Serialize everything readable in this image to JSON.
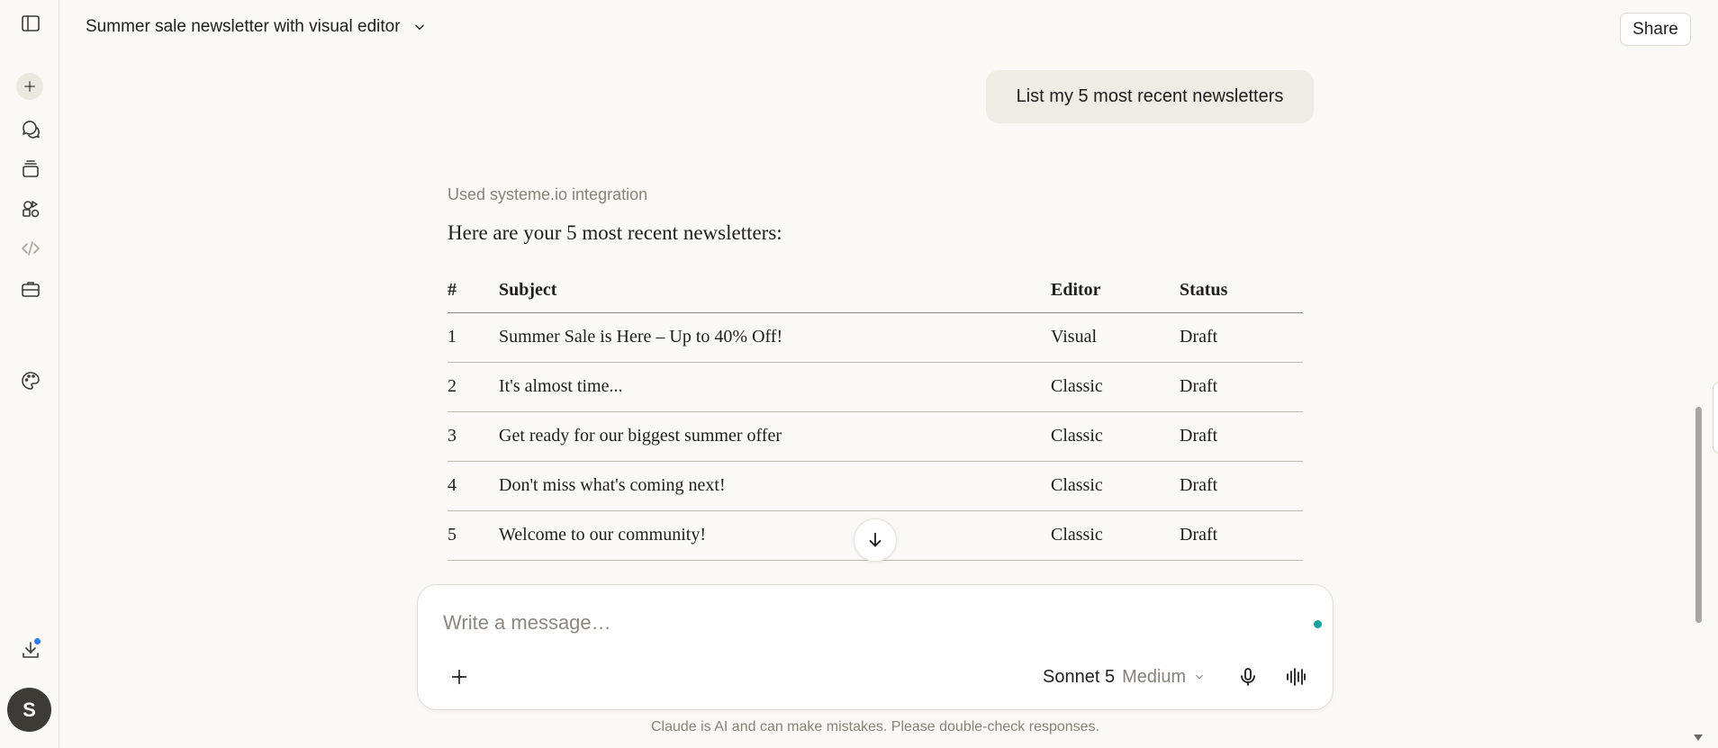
{
  "header": {
    "conversation_title": "Summer sale newsletter with visual editor",
    "share_label": "Share"
  },
  "sidebar": {
    "icons": [
      "sidebar-toggle-icon",
      "plus-icon",
      "chats-icon",
      "projects-icon",
      "artifacts-icon",
      "code-icon",
      "briefcase-icon",
      "palette-icon",
      "download-icon"
    ],
    "avatar_initial": "S"
  },
  "conversation": {
    "user_message": "List my 5 most recent newsletters",
    "tool_used": "Used systeme.io integration",
    "intro": "Here are your 5 most recent newsletters:",
    "table": {
      "headers": [
        "#",
        "Subject",
        "Editor",
        "Status"
      ],
      "rows": [
        [
          "1",
          "Summer Sale is Here – Up to 40% Off!",
          "Visual",
          "Draft"
        ],
        [
          "2",
          "It's almost time...",
          "Classic",
          "Draft"
        ],
        [
          "3",
          "Get ready for our biggest summer offer",
          "Classic",
          "Draft"
        ],
        [
          "4",
          "Don't miss what's coming next!",
          "Classic",
          "Draft"
        ],
        [
          "5",
          "Welcome to our community!",
          "Classic",
          "Draft"
        ]
      ]
    }
  },
  "composer": {
    "placeholder": "Write a message…",
    "model_name": "Sonnet 5",
    "effort": "Medium"
  },
  "disclaimer": "Claude is AI and can make mistakes. Please double-check responses.",
  "colors": {
    "background": "#faf9f5",
    "accent_teal": "#1aa39a",
    "notification_blue": "#2b7de9"
  }
}
